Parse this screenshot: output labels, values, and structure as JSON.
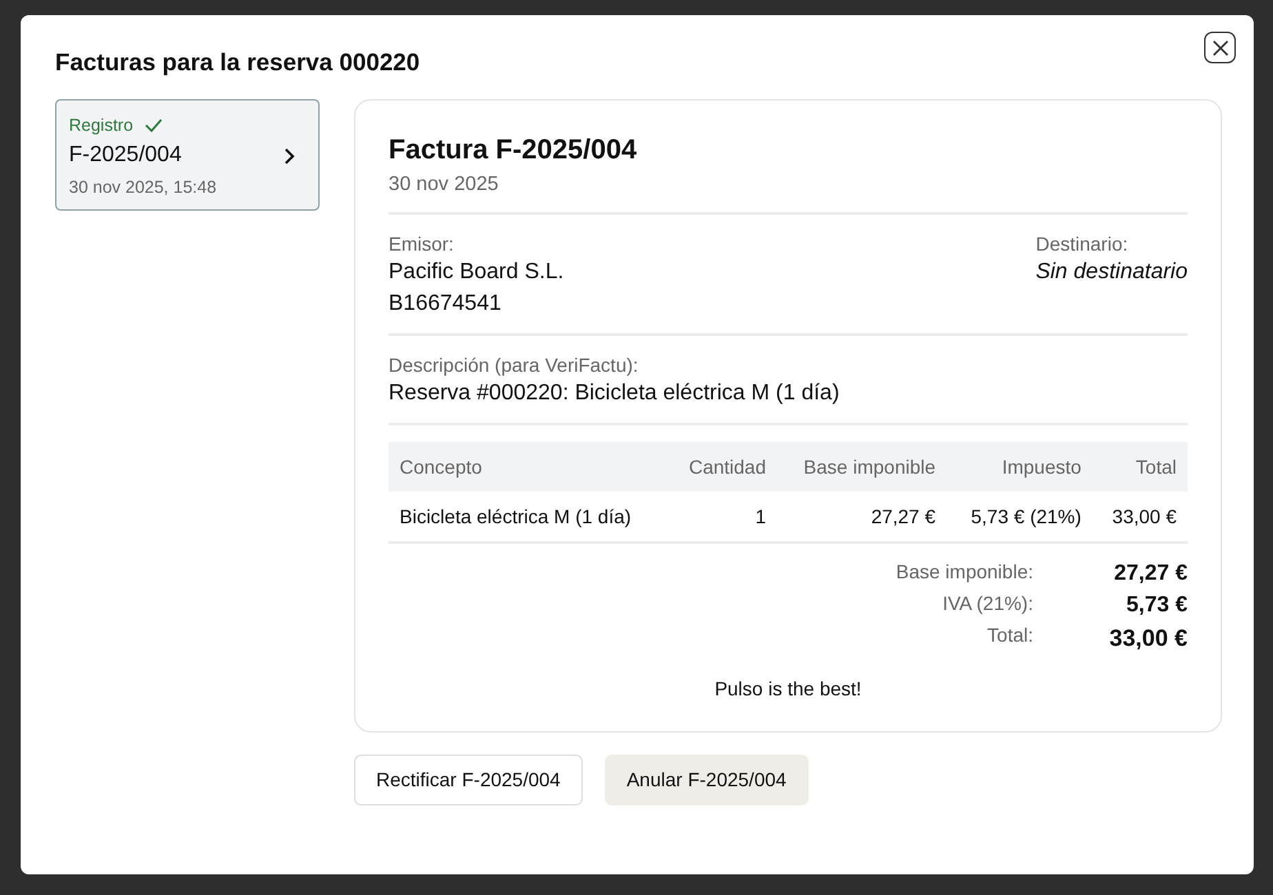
{
  "modal": {
    "title": "Facturas para la reserva 000220"
  },
  "invoices": [
    {
      "status": "Registro",
      "registered": true,
      "number": "F-2025/004",
      "datetime": "30 nov 2025, 15:48",
      "selected": true
    }
  ],
  "invoice": {
    "title": "Factura F-2025/004",
    "date": "30 nov 2025",
    "issuer_label": "Emisor:",
    "issuer_name": "Pacific Board S.L.",
    "issuer_tax_id": "B16674541",
    "recipient_label": "Destinario:",
    "recipient": "Sin destinatario",
    "description_label": "Descripción (para VeriFactu):",
    "description": "Reserva #000220: Bicicleta eléctrica M (1 día)",
    "table": {
      "columns": [
        "Concepto",
        "Cantidad",
        "Base imponible",
        "Impuesto",
        "Total"
      ],
      "rows": [
        [
          "Bicicleta eléctrica M (1 día)",
          "1",
          "27,27 €",
          "5,73 € (21%)",
          "33,00 €"
        ]
      ]
    },
    "totals": [
      {
        "label": "Base imponible:",
        "value": "27,27 €"
      },
      {
        "label": "IVA (21%):",
        "value": "5,73 €"
      },
      {
        "label": "Total:",
        "value": "33,00 €"
      }
    ],
    "footer_note": "Pulso is the best!"
  },
  "buttons": [
    {
      "label": "Rectificar F-2025/004",
      "kind": "outline"
    },
    {
      "label": "Anular F-2025/004",
      "kind": "secondary"
    }
  ]
}
